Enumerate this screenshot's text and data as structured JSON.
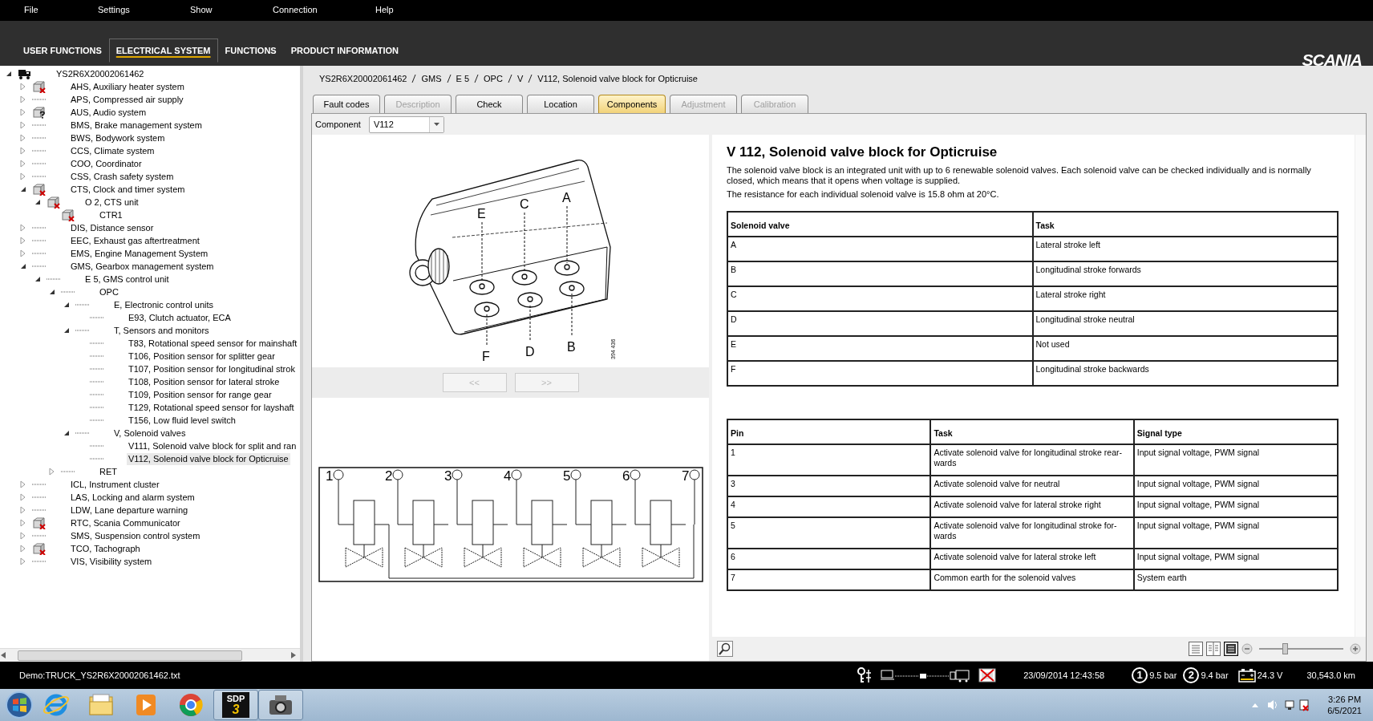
{
  "menu": [
    "File",
    "Settings",
    "Show",
    "Connection",
    "Help"
  ],
  "nav_tabs": [
    {
      "label": "USER FUNCTIONS",
      "selected": false
    },
    {
      "label": "ELECTRICAL SYSTEM",
      "selected": true
    },
    {
      "label": "FUNCTIONS",
      "selected": false
    },
    {
      "label": "PRODUCT INFORMATION",
      "selected": false
    }
  ],
  "logo": "SCANIA",
  "tree": {
    "label": "YS2R6X20002061462",
    "kind": "vehicle",
    "expanded": true,
    "selected": false,
    "children": [
      {
        "label": "AHS, Auxiliary heater system",
        "kind": "fault",
        "expanded": false,
        "selected": false
      },
      {
        "label": "APS, Compressed air supply",
        "kind": "plain",
        "expanded": false,
        "selected": false
      },
      {
        "label": "AUS, Audio system",
        "kind": "unknown",
        "expanded": false,
        "selected": false
      },
      {
        "label": "BMS, Brake management system",
        "kind": "plain",
        "expanded": false,
        "selected": false
      },
      {
        "label": "BWS, Bodywork system",
        "kind": "plain",
        "expanded": false,
        "selected": false
      },
      {
        "label": "CCS, Climate system",
        "kind": "plain",
        "expanded": false,
        "selected": false
      },
      {
        "label": "COO, Coordinator",
        "kind": "plain",
        "expanded": false,
        "selected": false
      },
      {
        "label": "CSS, Crash safety system",
        "kind": "plain",
        "expanded": false,
        "selected": false
      },
      {
        "label": "CTS, Clock and timer system",
        "kind": "fault",
        "expanded": true,
        "selected": false,
        "children": [
          {
            "label": "O 2, CTS unit",
            "kind": "fault",
            "expanded": true,
            "selected": false,
            "children": [
              {
                "label": "CTR1",
                "kind": "fault",
                "selected": false
              }
            ]
          }
        ]
      },
      {
        "label": "DIS, Distance sensor",
        "kind": "plain",
        "expanded": false,
        "selected": false
      },
      {
        "label": "EEC, Exhaust gas aftertreatment",
        "kind": "plain",
        "expanded": false,
        "selected": false
      },
      {
        "label": "EMS, Engine Management System",
        "kind": "plain",
        "expanded": false,
        "selected": false
      },
      {
        "label": "GMS, Gearbox management system",
        "kind": "plain",
        "expanded": true,
        "selected": false,
        "children": [
          {
            "label": "E 5, GMS control unit",
            "kind": "plain",
            "expanded": true,
            "selected": false,
            "children": [
              {
                "label": "OPC",
                "kind": "plain",
                "expanded": true,
                "selected": false,
                "children": [
                  {
                    "label": "E, Electronic control units",
                    "kind": "plain",
                    "expanded": true,
                    "selected": false,
                    "children": [
                      {
                        "label": "E93, Clutch actuator, ECA",
                        "kind": "plain",
                        "selected": false
                      }
                    ]
                  },
                  {
                    "label": "T, Sensors and monitors",
                    "kind": "plain",
                    "expanded": true,
                    "selected": false,
                    "children": [
                      {
                        "label": "T83, Rotational speed sensor for mainshaft",
                        "kind": "plain",
                        "selected": false
                      },
                      {
                        "label": "T106, Position sensor for splitter gear",
                        "kind": "plain",
                        "selected": false
                      },
                      {
                        "label": "T107, Position sensor for longitudinal strok",
                        "kind": "plain",
                        "selected": false
                      },
                      {
                        "label": "T108, Position sensor for lateral stroke",
                        "kind": "plain",
                        "selected": false
                      },
                      {
                        "label": "T109, Position sensor for range gear",
                        "kind": "plain",
                        "selected": false
                      },
                      {
                        "label": "T129, Rotational speed sensor for layshaft",
                        "kind": "plain",
                        "selected": false
                      },
                      {
                        "label": "T156, Low fluid level switch",
                        "kind": "plain",
                        "selected": false
                      }
                    ]
                  },
                  {
                    "label": "V, Solenoid valves",
                    "kind": "plain",
                    "expanded": true,
                    "selected": false,
                    "children": [
                      {
                        "label": "V111, Solenoid valve block for split and ran",
                        "kind": "plain",
                        "selected": false
                      },
                      {
                        "label": "V112, Solenoid valve block for Opticruise",
                        "kind": "plain",
                        "selected": true
                      }
                    ]
                  }
                ]
              },
              {
                "label": "RET",
                "kind": "plain",
                "expanded": false,
                "selected": false
              }
            ]
          }
        ]
      },
      {
        "label": "ICL, Instrument cluster",
        "kind": "plain",
        "expanded": false,
        "selected": false
      },
      {
        "label": "LAS, Locking and alarm system",
        "kind": "plain",
        "expanded": false,
        "selected": false
      },
      {
        "label": "LDW, Lane departure warning",
        "kind": "plain",
        "expanded": false,
        "selected": false
      },
      {
        "label": "RTC, Scania Communicator",
        "kind": "fault",
        "expanded": false,
        "selected": false
      },
      {
        "label": "SMS, Suspension control system",
        "kind": "plain",
        "expanded": false,
        "selected": false
      },
      {
        "label": "TCO, Tachograph",
        "kind": "fault",
        "expanded": false,
        "selected": false
      },
      {
        "label": "VIS, Visibility system",
        "kind": "plain",
        "expanded": false,
        "selected": false
      }
    ]
  },
  "breadcrumb": [
    "YS2R6X20002061462",
    "GMS",
    "E 5",
    "OPC",
    "V",
    "V112, Solenoid valve block for Opticruise"
  ],
  "tabs": [
    {
      "label": "Fault codes",
      "selected": false,
      "disabled": false
    },
    {
      "label": "Description",
      "selected": false,
      "disabled": true
    },
    {
      "label": "Check",
      "selected": false,
      "disabled": false
    },
    {
      "label": "Location",
      "selected": false,
      "disabled": false
    },
    {
      "label": "Components",
      "selected": true,
      "disabled": false
    },
    {
      "label": "Adjustment",
      "selected": false,
      "disabled": true
    },
    {
      "label": "Calibration",
      "selected": false,
      "disabled": true
    }
  ],
  "component": {
    "label": "Component",
    "value": "V112"
  },
  "figure": {
    "callouts": [
      {
        "label": "E"
      },
      {
        "label": "C"
      },
      {
        "label": "A"
      },
      {
        "label": "F"
      },
      {
        "label": "D"
      },
      {
        "label": "B"
      }
    ],
    "code": "394 436"
  },
  "pager": [
    {
      "label": "<<",
      "disabled": true
    },
    {
      "label": ">>",
      "disabled": true
    }
  ],
  "wiring": {
    "pins": [
      "1",
      "2",
      "3",
      "4",
      "5",
      "6",
      "7"
    ]
  },
  "doc": {
    "title": "V 112, Solenoid valve block for Opticruise",
    "paragraphs": [
      "The solenoid valve block is an integrated unit with up to 6 renewable solenoid valves. Each solenoid valve can be checked individually and is normally closed, which means that it opens when voltage is supplied.",
      "The resistance for each individual solenoid valve is 15.8 ohm at 20°C."
    ],
    "tables": [
      {
        "columns": [
          "Solenoid valve",
          "Task"
        ],
        "rows": [
          [
            "A",
            "Lateral stroke left"
          ],
          [
            "B",
            "Longitudinal stroke forwards"
          ],
          [
            "C",
            "Lateral stroke right"
          ],
          [
            "D",
            "Longitudinal stroke neutral"
          ],
          [
            "E",
            "Not used"
          ],
          [
            "F",
            "Longitudinal stroke backwards"
          ]
        ]
      },
      {
        "columns": [
          "Pin",
          "Task",
          "Signal type"
        ],
        "rows": [
          [
            "1",
            "Activate solenoid valve for longitudinal stroke rear-\nwards",
            "Input signal voltage, PWM signal"
          ],
          [
            "3",
            "Activate solenoid valve for neutral",
            "Input signal voltage, PWM signal"
          ],
          [
            "4",
            "Activate solenoid valve for lateral stroke right",
            "Input signal voltage, PWM signal"
          ],
          [
            "5",
            "Activate solenoid valve for longitudinal stroke for-\nwards",
            "Input signal voltage, PWM signal"
          ],
          [
            "6",
            "Activate solenoid valve for lateral stroke left",
            "Input signal voltage, PWM signal"
          ],
          [
            "7",
            "Common earth for the solenoid valves",
            "System earth"
          ]
        ]
      }
    ]
  },
  "zoom": {
    "level": 0.3
  },
  "status_bar": {
    "file": "Demo:TRUCK_YS2R6X20002061462.txt",
    "datetime": "23/09/2014 12:43:58",
    "pressures": [
      {
        "circuit": "1",
        "reading": "9.5 bar"
      },
      {
        "circuit": "2",
        "reading": "9.4 bar"
      }
    ],
    "voltage": "24.3 V",
    "odometer": "30,543.0 km"
  },
  "taskbar": {
    "apps": [
      {
        "kind": "ie"
      },
      {
        "kind": "folder"
      },
      {
        "kind": "media"
      },
      {
        "kind": "chrome"
      },
      {
        "kind": "sdp",
        "label": "SDP",
        "badge": "3"
      },
      {
        "kind": "camera"
      }
    ],
    "time": "3:26 PM",
    "date": "6/5/2021"
  }
}
